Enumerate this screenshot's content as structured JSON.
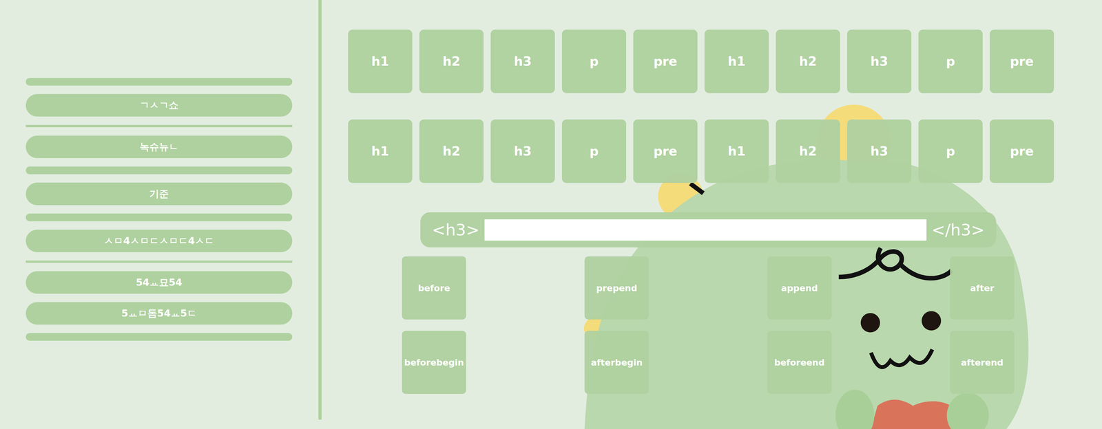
{
  "sidebar": {
    "items": [
      {
        "kind": "bar"
      },
      {
        "kind": "button",
        "label": "ㄱㅅㄱ쇼"
      },
      {
        "kind": "line"
      },
      {
        "kind": "button",
        "label": "녹슈뉴ㄴ"
      },
      {
        "kind": "bar"
      },
      {
        "kind": "button",
        "label": "기준"
      },
      {
        "kind": "bar"
      },
      {
        "kind": "button",
        "label": "ㅅㅁ4ㅅㅁㄷㅅㅁㄷ4ㅅㄷ"
      },
      {
        "kind": "line"
      },
      {
        "kind": "button",
        "label": "54ㅛ묘54"
      },
      {
        "kind": "button",
        "label": "5ㅛㅁ돔54ㅛ5ㄷ"
      },
      {
        "kind": "bar"
      }
    ]
  },
  "tiles": [
    [
      "h1",
      "h2",
      "h3",
      "p",
      "pre",
      "h1",
      "h2",
      "h3",
      "p",
      "pre"
    ],
    [
      "h1",
      "h2",
      "h3",
      "p",
      "pre",
      "h1",
      "h2",
      "h3",
      "p",
      "pre"
    ]
  ],
  "editor": {
    "open_tag": "<h3>",
    "close_tag": "</h3>",
    "value": ""
  },
  "insert_buttons": [
    [
      "before",
      "prepend",
      "append",
      "after"
    ],
    [
      "beforebegin",
      "afterbegin",
      "beforeend",
      "afterend"
    ]
  ]
}
